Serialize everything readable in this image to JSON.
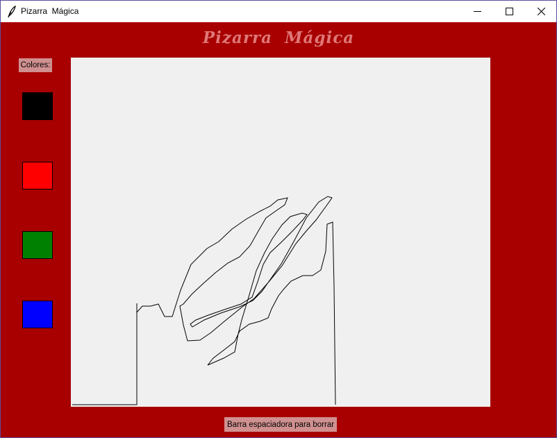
{
  "window": {
    "title": "Pizarra  Mágica",
    "icon": "feather-icon",
    "controls": [
      "minimize-icon",
      "maximize-icon",
      "close-icon"
    ]
  },
  "app": {
    "heading": "Pizarra  Mágica",
    "colors_label": "Colores:",
    "hint": "Barra espaciadora para borrar"
  },
  "palette": [
    {
      "name": "black",
      "color": "#000000"
    },
    {
      "name": "red",
      "color": "#ff0000"
    },
    {
      "name": "green",
      "color": "#008000"
    },
    {
      "name": "blue",
      "color": "#0000ff"
    }
  ],
  "colors": {
    "background": "#a80000",
    "heading": "#e07878",
    "label_bg": "#d09090",
    "canvas_bg": "#f0f0f0",
    "stroke": "#000000"
  }
}
